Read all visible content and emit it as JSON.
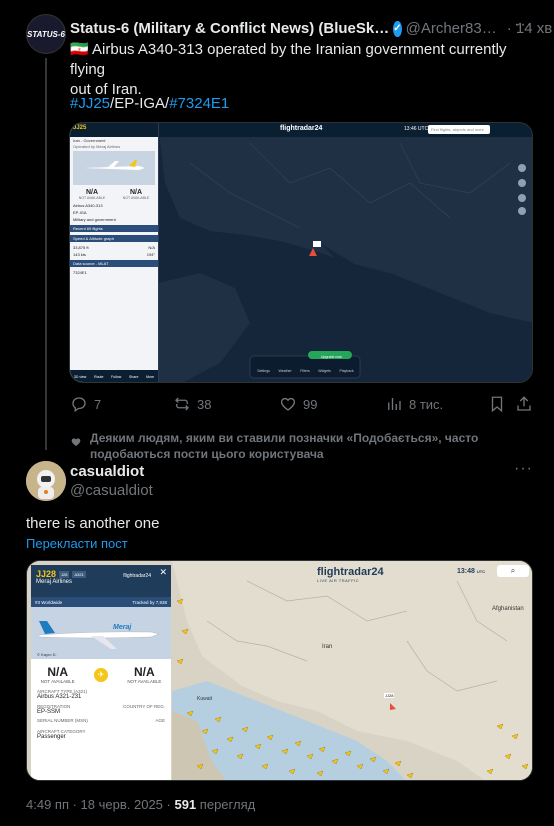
{
  "post1": {
    "name": "Status-6 (Military & Conflict News) (BlueSk…",
    "handle": "@Archer83…",
    "time": "· 14 хв",
    "avatar_text": "STATUS-6",
    "flag": "🇮🇷",
    "text_line1": "Airbus A340-313 operated by the Iranian government currently flying",
    "text_line2": "out of Iran.",
    "tags": [
      "#JJ25",
      "/EP-IGA/",
      "#7324E1"
    ],
    "screenshot": {
      "brand": "flightradar24",
      "time": "13:46 UTC",
      "search_placeholder": "Find flights, airports and more",
      "flight": "JJ25",
      "operator": "Iran - Government",
      "operated_by": "Operated by Meraj Airlines",
      "na1": "N/A",
      "na2": "N/A",
      "not_available": "NOT AVAILABLE",
      "aircraft_type": "Airbus A340-313",
      "registration": "EP-IGA",
      "category": "Military and government",
      "section1": "Recent 69 flights",
      "section2": "Speed & Altitude graph",
      "section3": "Data source - MLAT",
      "baro_alt": "33,875 ft",
      "gps_alt": "N/A",
      "ground_speed": "143 kts",
      "true_airspeed": "N/A",
      "track": "194°",
      "icao": "7324E1",
      "upgrade": "Upgrade now",
      "bottom_items": [
        "Settings",
        "Weather",
        "Filters",
        "Widgets",
        "Playback"
      ],
      "panel_tabs": [
        "3D view",
        "Route",
        "Follow",
        "Share",
        "More"
      ]
    },
    "actions": {
      "replies": "7",
      "reposts": "38",
      "likes": "99",
      "views": "8 тис."
    }
  },
  "liked_note": "Деяким людям, яким ви ставили позначки «Подобається», часто",
  "liked_note2": "подобаються пости цього користувача",
  "post2": {
    "name": "casualdiot",
    "handle": "@casualdiot",
    "text": "there is another one",
    "translate": "Перекласти пост",
    "screenshot": {
      "flight": "JJ28",
      "badge1": "J28",
      "badge2": "A321",
      "airline": "Meraj Airlines",
      "rank": "#3 Worldwide",
      "tracked": "Tracked by 7,938",
      "brand": "flightradar24",
      "brand_sub": "LIVE AIR TRAFFIC",
      "time": "13:48",
      "utc": "UTC",
      "photo_credit": "© Kayro D.",
      "na1": "N/A",
      "na2": "N/A",
      "not_available": "NOT AVAILABLE",
      "aircraft_type_label": "AIRCRAFT TYPE (A321)",
      "aircraft_type": "Airbus A321-231",
      "registration_label": "REGISTRATION",
      "registration": "EP-SSM",
      "country_label": "COUNTRY OF REG.",
      "msn_label": "SERIAL NUMBER (MSN)",
      "age_label": "AGE",
      "category_label": "AIRCRAFT CATEGORY",
      "category": "Passenger",
      "map_labels": [
        "Afghanistan",
        "Kuwait",
        "Iran"
      ],
      "aircraft_marker": "JJ28",
      "livery": "Meraj"
    },
    "meta_time": "4:49 пп · 18 черв. 2025 ·",
    "meta_views": "591",
    "meta_views_label": "перегляд"
  },
  "colors": {
    "accent": "#1d9bf0",
    "secondary": "#71767b",
    "text": "#e7e9ea",
    "fr_yellow": "#f5c518"
  }
}
